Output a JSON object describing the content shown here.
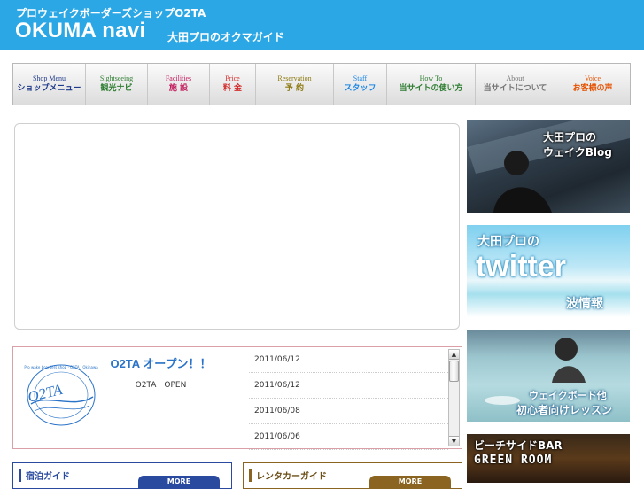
{
  "header": {
    "subtitle": "プロウェイクボーダーズショップO2TA",
    "title": "OKUMA navi",
    "tagline": "大田プロのオクマガイド",
    "bg_color": "#2ba7e6"
  },
  "nav": {
    "items": [
      {
        "en": "Shop Menu",
        "jp": "ショップメニュー",
        "color": "#1e3a8a"
      },
      {
        "en": "Sightseeing",
        "jp": "観光ナビ",
        "color": "#2e7d32"
      },
      {
        "en": "Facilities",
        "jp": "施 設",
        "color": "#c2185b"
      },
      {
        "en": "Price",
        "jp": "料 金",
        "color": "#d32f2f"
      },
      {
        "en": "Reservation",
        "jp": "予 約",
        "color": "#8d7a10"
      },
      {
        "en": "Staff",
        "jp": "スタッフ",
        "color": "#1e88e5"
      },
      {
        "en": "How To",
        "jp": "当サイトの使い方",
        "color": "#2e7d32"
      },
      {
        "en": "About",
        "jp": "当サイトについて",
        "color": "#757575"
      },
      {
        "en": "Voice",
        "jp": "お客様の声",
        "color": "#e65100"
      }
    ]
  },
  "news": {
    "title": "O2TA オープン！！",
    "body": "O2TA　OPEN",
    "dates": [
      "2011/06/12",
      "2011/06/12",
      "2011/06/08",
      "2011/06/06"
    ],
    "logo_text": "O2TA",
    "logo_ring": "Pro wake boarders shop · O2TA · Okinawa"
  },
  "guides": [
    {
      "title": "宿泊ガイド",
      "more": "MORE",
      "color": "#2a4aa0"
    },
    {
      "title": "レンタカーガイド",
      "more": "MORE",
      "color": "#8a6420"
    }
  ],
  "sidebar": {
    "blog": {
      "line1": "大田プロの",
      "line2": "ウェイクBlog"
    },
    "twitter": {
      "line1": "大田プロの",
      "logo": "twitter",
      "line2": "波情報"
    },
    "lesson": {
      "line1": "ウェイクボード他",
      "line2": "初心者向けレッスン"
    },
    "bar": {
      "line1": "ビーチサイドBAR",
      "line2": "GREEN ROOM"
    }
  }
}
